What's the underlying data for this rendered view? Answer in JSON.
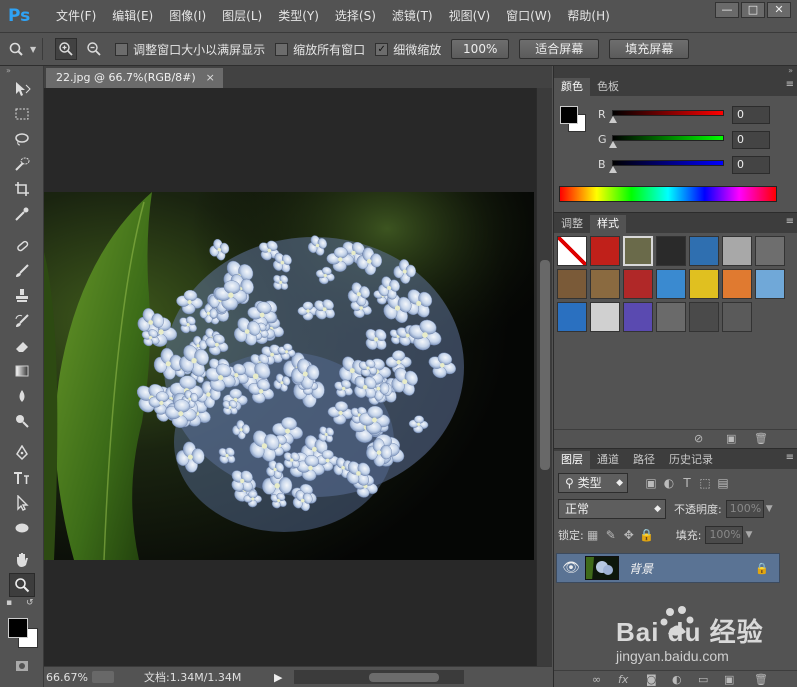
{
  "app": {
    "logo": "Ps"
  },
  "menu": [
    "文件(F)",
    "编辑(E)",
    "图像(I)",
    "图层(L)",
    "类型(Y)",
    "选择(S)",
    "滤镜(T)",
    "视图(V)",
    "窗口(W)",
    "帮助(H)"
  ],
  "window_controls": [
    "—",
    "□",
    "✕"
  ],
  "options": {
    "resize_windows": "调整窗口大小以满屏显示",
    "resize_checked": false,
    "zoom_all": "缩放所有窗口",
    "zoom_all_checked": false,
    "scrubby": "细微缩放",
    "scrubby_checked": true,
    "btn_100": "100%",
    "btn_fit": "适合屏幕",
    "btn_fill": "填充屏幕"
  },
  "document": {
    "tab_title": "22.jpg @ 66.7%(RGB/8#)",
    "close": "×"
  },
  "status": {
    "zoom": "66.67%",
    "doc_size": "文档:1.34M/1.34M",
    "arrow": "▶"
  },
  "color_panel": {
    "tabs": [
      "颜色",
      "色板"
    ],
    "rows": [
      {
        "label": "R",
        "value": "0",
        "color": "#ff0000"
      },
      {
        "label": "G",
        "value": "0",
        "color": "#00ff00"
      },
      {
        "label": "B",
        "value": "0",
        "color": "#0000ff"
      }
    ],
    "foreground": "#000000",
    "background": "#ffffff"
  },
  "styles_panel": {
    "tabs": [
      "调整",
      "样式"
    ],
    "swatches": [
      "#ffffff",
      "#c0201a",
      "#6a6a4a",
      "#2a2a2a",
      "#2f6fb0",
      "#a8a8a8",
      "#6e6e6e",
      "#7a5a38",
      "#8a6a40",
      "#b02828",
      "#3a8ad0",
      "#e0c020",
      "#e07a30",
      "#70a8d8",
      "#2a70c0",
      "#d0d0d0",
      "#5a4ab0",
      "#6a6a6a",
      "#4a4a4a",
      "#5a5a5a"
    ]
  },
  "layers_panel": {
    "tabs": [
      "图层",
      "通道",
      "路径",
      "历史记录"
    ],
    "filter": "类型",
    "blend_mode": "正常",
    "opacity_label": "不透明度:",
    "opacity_value": "100%",
    "lock_label": "锁定:",
    "fill_label": "填充:",
    "fill_value": "100%",
    "layer_name": "背景"
  },
  "watermark": {
    "brand": "Bai du 经验",
    "url": "jingyan.baidu.com"
  }
}
